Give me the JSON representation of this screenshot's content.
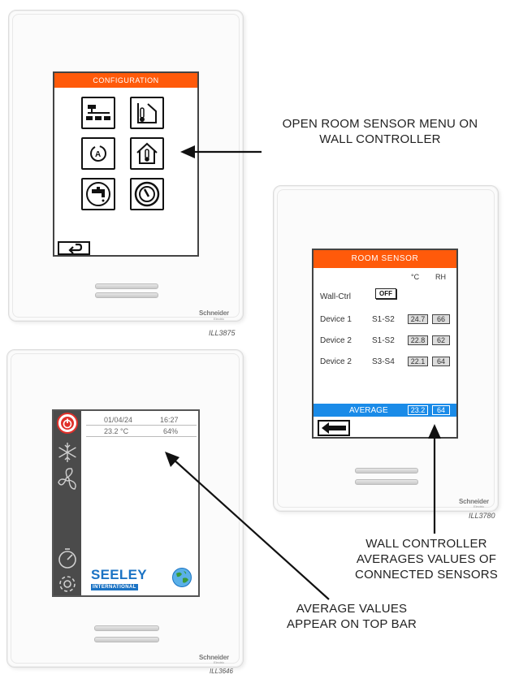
{
  "panel_config": {
    "header": "CONFIGURATION",
    "brand": "Schneider",
    "brand_sub": "Electric",
    "ill_code": "ILL3875",
    "buttons": [
      {
        "icon": "network-icon"
      },
      {
        "icon": "room-temperature-icon"
      },
      {
        "icon": "auto-mode-icon"
      },
      {
        "icon": "room-sensor-icon"
      },
      {
        "icon": "water-tap-icon"
      },
      {
        "icon": "gauge-icon"
      }
    ],
    "back_icon": "return-icon"
  },
  "panel_room_sensor": {
    "header": "ROOM SENSOR",
    "col_celsius": "°C",
    "col_rh": "RH",
    "wall_ctrl_label": "Wall-Ctrl",
    "wall_ctrl_value": "OFF",
    "rows": [
      {
        "device": "Device 1",
        "sensors": "S1-S2",
        "temp": "24.7",
        "rh": "66"
      },
      {
        "device": "Device 2",
        "sensors": "S1-S2",
        "temp": "22.8",
        "rh": "62"
      },
      {
        "device": "Device 2",
        "sensors": "S3-S4",
        "temp": "22.1",
        "rh": "64"
      }
    ],
    "average_label": "AVERAGE",
    "average_temp": "23.2",
    "average_rh": "64",
    "brand": "Schneider",
    "brand_sub": "Electric",
    "ill_code": "ILL3780"
  },
  "panel_home": {
    "date": "01/04/24",
    "time": "16:27",
    "temp": "23.2 °C",
    "humidity": "64%",
    "logo_main": "SEELEY",
    "logo_sub": "INTERNATIONAL",
    "brand": "Schneider",
    "brand_sub": "Electric",
    "ill_code": "ILL3646"
  },
  "callouts": {
    "open_menu_line1": "OPEN ROOM SENSOR MENU ON",
    "open_menu_line2": "WALL CONTROLLER",
    "averages_line1": "WALL CONTROLLER",
    "averages_line2": "AVERAGES VALUES OF",
    "averages_line3": "CONNECTED SENSORS",
    "top_bar_line1": "AVERAGE VALUES",
    "top_bar_line2": "APPEAR ON TOP BAR"
  },
  "colors": {
    "header_orange": "#ff5a0a",
    "average_blue": "#1a8be8",
    "power_red": "#e0302a",
    "sidebar_grey": "#4b4b4b",
    "seeley_blue": "#1b73c4"
  }
}
